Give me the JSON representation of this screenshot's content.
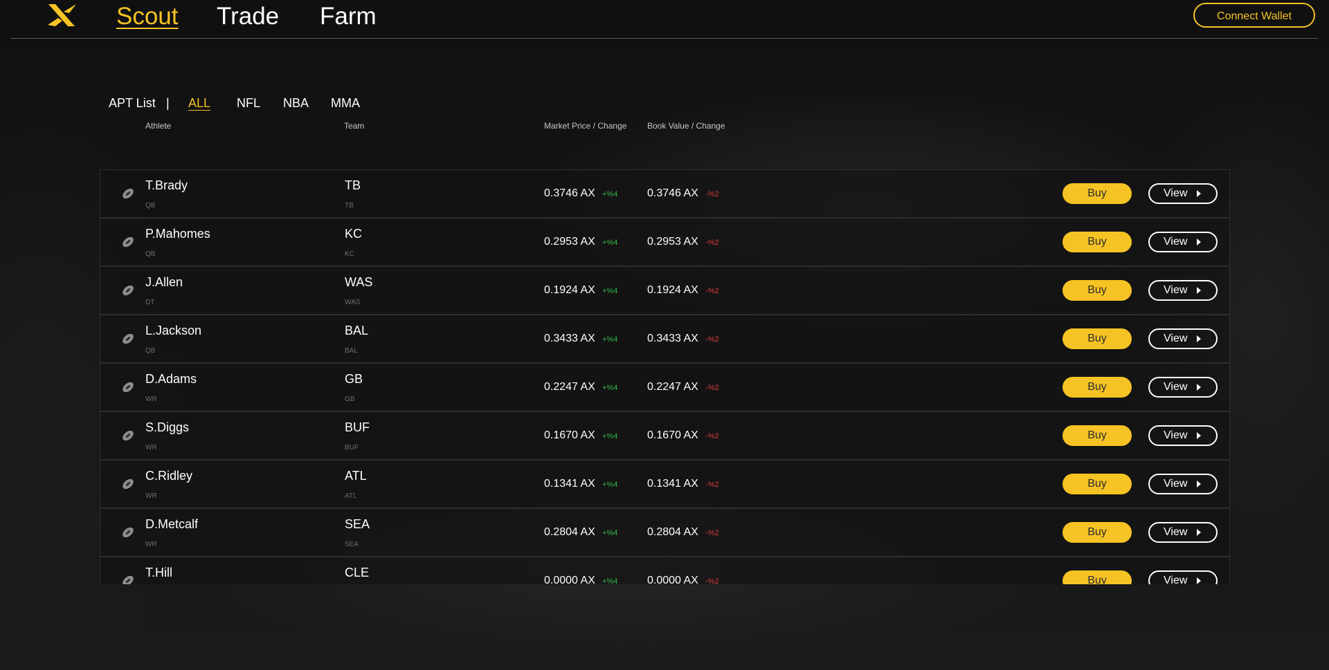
{
  "header": {
    "nav": [
      {
        "label": "Scout",
        "active": true
      },
      {
        "label": "Trade",
        "active": false
      },
      {
        "label": "Farm",
        "active": false
      }
    ],
    "connect_wallet": "Connect Wallet"
  },
  "filters": {
    "list_label": "APT List",
    "separator": "|",
    "tabs": [
      {
        "label": "ALL",
        "active": true
      },
      {
        "label": "NFL",
        "active": false
      },
      {
        "label": "NBA",
        "active": false
      },
      {
        "label": "MMA",
        "active": false
      }
    ]
  },
  "columns": {
    "athlete": "Athlete",
    "team": "Team",
    "market": "Market Price / Change",
    "book": "Book Value / Change"
  },
  "buttons": {
    "buy": "Buy",
    "view": "View"
  },
  "colors": {
    "accent": "#f6c324",
    "positive": "#35b84a",
    "negative": "#e03b3b"
  },
  "icons": {
    "logo": "x-logo",
    "sport": "football-icon",
    "view": "caret-right-icon"
  },
  "rows": [
    {
      "name": "T.Brady",
      "pos": "QB",
      "team": "TB",
      "team_sub": "TB",
      "price": "0.3746 AX",
      "price_change": "+%4",
      "book": "0.3746 AX",
      "book_change": "-%2"
    },
    {
      "name": "P.Mahomes",
      "pos": "QB",
      "team": "KC",
      "team_sub": "KC",
      "price": "0.2953 AX",
      "price_change": "+%4",
      "book": "0.2953 AX",
      "book_change": "-%2"
    },
    {
      "name": "J.Allen",
      "pos": "DT",
      "team": "WAS",
      "team_sub": "WAS",
      "price": "0.1924 AX",
      "price_change": "+%4",
      "book": "0.1924 AX",
      "book_change": "-%2"
    },
    {
      "name": "L.Jackson",
      "pos": "QB",
      "team": "BAL",
      "team_sub": "BAL",
      "price": "0.3433 AX",
      "price_change": "+%4",
      "book": "0.3433 AX",
      "book_change": "-%2"
    },
    {
      "name": "D.Adams",
      "pos": "WR",
      "team": "GB",
      "team_sub": "GB",
      "price": "0.2247 AX",
      "price_change": "+%4",
      "book": "0.2247 AX",
      "book_change": "-%2"
    },
    {
      "name": "S.Diggs",
      "pos": "WR",
      "team": "BUF",
      "team_sub": "BUF",
      "price": "0.1670 AX",
      "price_change": "+%4",
      "book": "0.1670 AX",
      "book_change": "-%2"
    },
    {
      "name": "C.Ridley",
      "pos": "WR",
      "team": "ATL",
      "team_sub": "ATL",
      "price": "0.1341 AX",
      "price_change": "+%4",
      "book": "0.1341 AX",
      "book_change": "-%2"
    },
    {
      "name": "D.Metcalf",
      "pos": "WR",
      "team": "SEA",
      "team_sub": "SEA",
      "price": "0.2804 AX",
      "price_change": "+%4",
      "book": "0.2804 AX",
      "book_change": "-%2"
    },
    {
      "name": "T.Hill",
      "pos": "",
      "team": "CLE",
      "team_sub": "",
      "price": "0.0000 AX",
      "price_change": "+%4",
      "book": "0.0000 AX",
      "book_change": "-%2"
    }
  ]
}
